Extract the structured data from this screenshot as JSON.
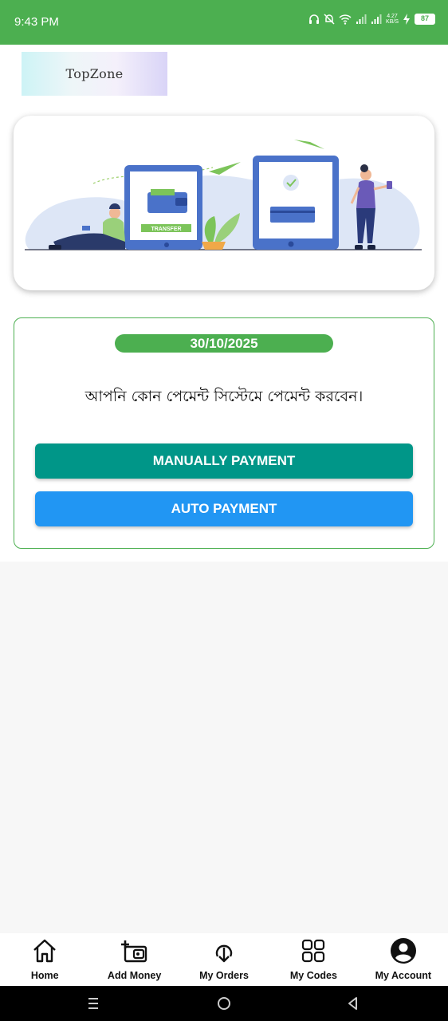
{
  "status_bar": {
    "time": "9:43 PM",
    "net_rate_top": "4.27",
    "net_rate_bottom": "KB/S",
    "battery": "87"
  },
  "header": {
    "logo_text": "TopZone"
  },
  "banner": {
    "transfer_label": "TRANSFER"
  },
  "payment": {
    "date": "30/10/2025",
    "question": "আপনি কোন পেমেন্ট সিস্টেমে পেমেন্ট করবেন।",
    "manual_label": "MANUALLY PAYMENT",
    "auto_label": "AUTO PAYMENT"
  },
  "bottom_nav": [
    {
      "label": "Home",
      "icon": "home-icon"
    },
    {
      "label": "Add Money",
      "icon": "add-money-icon"
    },
    {
      "label": "My Orders",
      "icon": "download-icon"
    },
    {
      "label": "My Codes",
      "icon": "grid-icon"
    },
    {
      "label": "My Account",
      "icon": "account-circle-icon"
    }
  ],
  "colors": {
    "brand_green": "#4caf50",
    "manual_button": "#009688",
    "auto_button": "#2196f3"
  }
}
